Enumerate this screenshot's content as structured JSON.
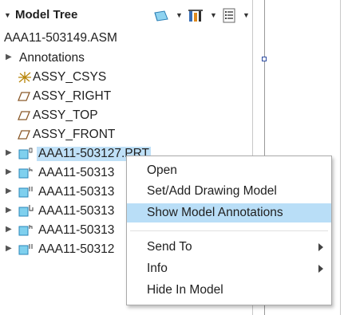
{
  "panel": {
    "title": "Model Tree",
    "collapse_glyph": "▼",
    "toolbar": [
      {
        "name": "display-icon",
        "has_dropdown": true
      },
      {
        "name": "tree-settings-icon",
        "has_dropdown": true
      },
      {
        "name": "list-icon",
        "has_dropdown": true
      }
    ]
  },
  "tree": {
    "root": "AAA11-503149.ASM",
    "items": [
      {
        "label": "Annotations",
        "icon": "none",
        "expander": "▶"
      },
      {
        "label": "ASSY_CSYS",
        "icon": "csys-icon",
        "expander": ""
      },
      {
        "label": "ASSY_RIGHT",
        "icon": "datum-plane-icon",
        "expander": ""
      },
      {
        "label": "ASSY_TOP",
        "icon": "datum-plane-icon",
        "expander": ""
      },
      {
        "label": "ASSY_FRONT",
        "icon": "datum-plane-icon",
        "expander": ""
      },
      {
        "label": "AAA11-503127.PRT",
        "icon": "part-icon",
        "expander": "▶",
        "selected": true
      },
      {
        "label": "AAA11-50313",
        "icon": "part-icon",
        "expander": "▶"
      },
      {
        "label": "AAA11-50313",
        "icon": "part-icon",
        "expander": "▶"
      },
      {
        "label": "AAA11-50313",
        "icon": "part-icon",
        "expander": "▶"
      },
      {
        "label": "AAA11-50313",
        "icon": "part-icon",
        "expander": "▶"
      },
      {
        "label": "AAA11-50312",
        "icon": "part-icon",
        "expander": "▶"
      }
    ]
  },
  "context_menu": {
    "items": [
      {
        "label": "Open"
      },
      {
        "label": "Set/Add Drawing Model"
      },
      {
        "label": "Show Model Annotations",
        "highlighted": true
      },
      {
        "label": "Send To",
        "submenu": true
      },
      {
        "label": "Info",
        "submenu": true
      },
      {
        "label": "Hide In Model"
      }
    ]
  },
  "colors": {
    "selection": "#bfe0f7",
    "menu_highlight": "#b9def7",
    "part_icon": "#4aaed9",
    "plane_icon": "#8a5a2b",
    "csys_icon": "#b8860b"
  }
}
